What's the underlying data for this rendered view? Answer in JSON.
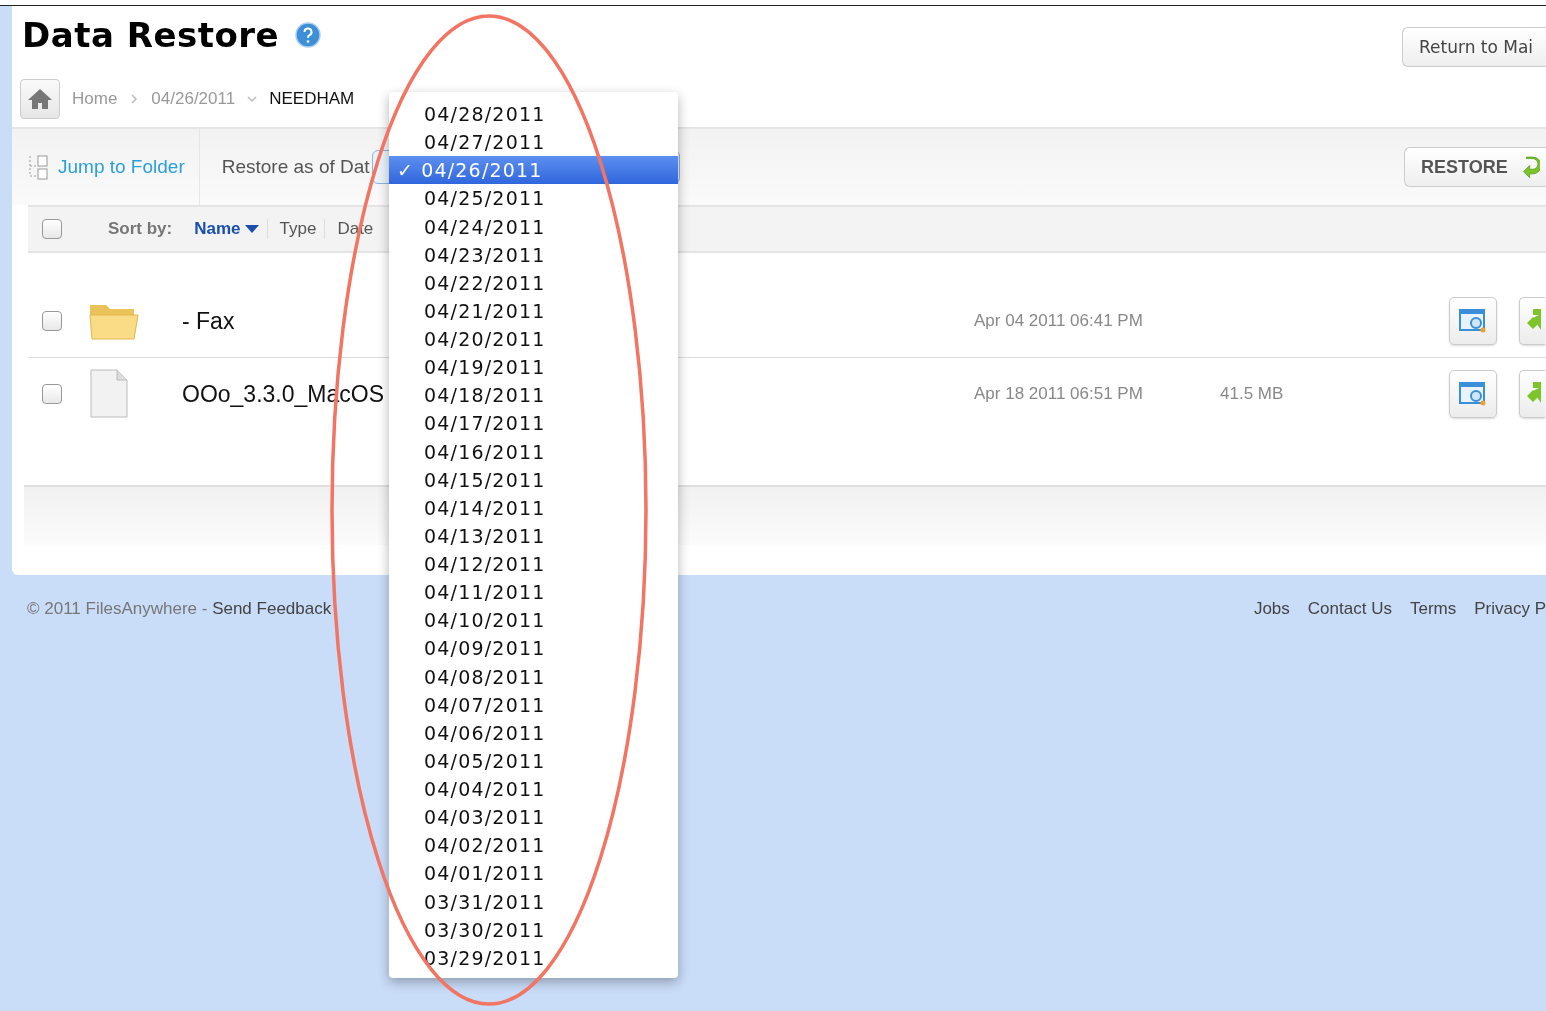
{
  "page": {
    "title": "Data Restore",
    "return_button": "Return to Mai"
  },
  "breadcrumb": [
    {
      "label": "Home",
      "kind": "link"
    },
    {
      "label": "04/26/2011",
      "kind": "link"
    },
    {
      "label": "NEEDHAM",
      "kind": "current"
    }
  ],
  "toolbar": {
    "jump": "Jump to Folder",
    "restore_label": "Restore as of Dat",
    "restore_button": "RESTORE"
  },
  "sort": {
    "label": "Sort by:",
    "all_checked": false,
    "options": [
      {
        "label": "Name",
        "selected": true
      },
      {
        "label": "Type",
        "selected": false
      },
      {
        "label": "Date",
        "selected": false
      }
    ]
  },
  "files": [
    {
      "kind": "folder",
      "name": "- Fax",
      "modified": "Apr 04 2011 06:41 PM",
      "checked": false
    },
    {
      "kind": "file",
      "name": "OOo_3.3.0_MacOS",
      "modified": "Apr 18 2011 06:51 PM",
      "size": "41.5 MB",
      "checked": false
    }
  ],
  "footer": {
    "copyright": "© 2011 FilesAnywhere - ",
    "feedback": "Send Feedback",
    "links": [
      "Jobs",
      "Contact Us",
      "Terms",
      "Privacy P"
    ]
  },
  "date_menu": {
    "check": "✓",
    "items": [
      {
        "label": "04/28/2011",
        "selected": false
      },
      {
        "label": "04/27/2011",
        "selected": false
      },
      {
        "label": "04/26/2011",
        "selected": true
      },
      {
        "label": "04/25/2011",
        "selected": false
      },
      {
        "label": "04/24/2011",
        "selected": false
      },
      {
        "label": "04/23/2011",
        "selected": false
      },
      {
        "label": "04/22/2011",
        "selected": false
      },
      {
        "label": "04/21/2011",
        "selected": false
      },
      {
        "label": "04/20/2011",
        "selected": false
      },
      {
        "label": "04/19/2011",
        "selected": false
      },
      {
        "label": "04/18/2011",
        "selected": false
      },
      {
        "label": "04/17/2011",
        "selected": false
      },
      {
        "label": "04/16/2011",
        "selected": false
      },
      {
        "label": "04/15/2011",
        "selected": false
      },
      {
        "label": "04/14/2011",
        "selected": false
      },
      {
        "label": "04/13/2011",
        "selected": false
      },
      {
        "label": "04/12/2011",
        "selected": false
      },
      {
        "label": "04/11/2011",
        "selected": false
      },
      {
        "label": "04/10/2011",
        "selected": false
      },
      {
        "label": "04/09/2011",
        "selected": false
      },
      {
        "label": "04/08/2011",
        "selected": false
      },
      {
        "label": "04/07/2011",
        "selected": false
      },
      {
        "label": "04/06/2011",
        "selected": false
      },
      {
        "label": "04/05/2011",
        "selected": false
      },
      {
        "label": "04/04/2011",
        "selected": false
      },
      {
        "label": "04/03/2011",
        "selected": false
      },
      {
        "label": "04/02/2011",
        "selected": false
      },
      {
        "label": "04/01/2011",
        "selected": false
      },
      {
        "label": "03/31/2011",
        "selected": false
      },
      {
        "label": "03/30/2011",
        "selected": false
      },
      {
        "label": "03/29/2011",
        "selected": false
      }
    ]
  }
}
